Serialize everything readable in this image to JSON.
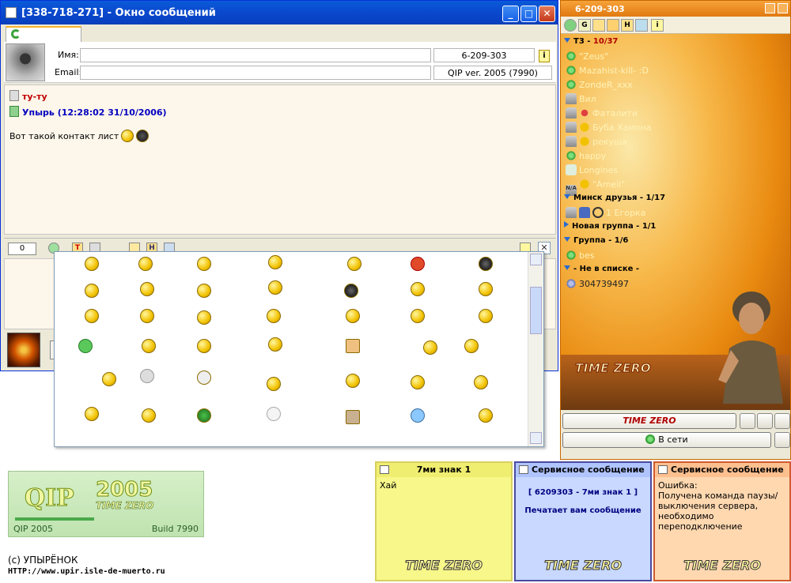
{
  "message_window": {
    "title": "[338-718-271] - Окно сообщений",
    "name_label": "Имя:",
    "email_label": "Email:",
    "uin": "6-209-303",
    "client": "QIP ver. 2005 (7990)",
    "messages": [
      {
        "author": "ту-ту"
      },
      {
        "author": "Упырь (12:28:02 31/10/2006)",
        "text": "Вот такой контакт лист"
      }
    ],
    "counter": "0",
    "toolbar_icons": [
      "T",
      "H"
    ]
  },
  "contact_list": {
    "title": "6-209-303",
    "toolbar_icons": [
      "G",
      "H",
      "i"
    ],
    "groups": [
      {
        "name": "Т3",
        "count": "10/37",
        "expanded": true,
        "contacts": [
          {
            "name": "\"Zeus\"",
            "icon": "flower-icon"
          },
          {
            "name": "Mazahist-kill- :D",
            "icon": "flower-icon"
          },
          {
            "name": "ZondeR_xxx",
            "icon": "flower-icon"
          },
          {
            "name": "Вил",
            "icon": "person-icon"
          },
          {
            "name": "Фаталити",
            "icon": "person-icon"
          },
          {
            "name": "Буба Хамона",
            "icon": "person-icon"
          },
          {
            "name": "рекуша",
            "icon": "person-icon"
          },
          {
            "name": "happy",
            "icon": "flower-icon"
          },
          {
            "name": "Longines",
            "icon": "chat-icon"
          },
          {
            "name": "\"Ameli\"",
            "icon": "na-icon"
          }
        ]
      },
      {
        "name": "Минск друзья",
        "count": "1/17",
        "expanded": true,
        "contacts": [
          {
            "name": "1 Егорка",
            "icon": "person-icon"
          }
        ]
      },
      {
        "name": "Новая группа",
        "count": "1/1",
        "expanded": false,
        "contacts": []
      },
      {
        "name": "Группа",
        "count": "1/6",
        "expanded": true,
        "contacts": [
          {
            "name": "bes",
            "icon": "flower-icon"
          }
        ]
      },
      {
        "name": "- Не в списке -",
        "count": "",
        "expanded": true,
        "contacts": [
          {
            "name": "304739497",
            "icon": "flower-icon"
          }
        ]
      }
    ],
    "logo": "TIME ZERO",
    "status_button": "В сети"
  },
  "banner": {
    "product": "QIP",
    "year": "2005",
    "sub": "TIME ZERO",
    "left": "QIP 2005",
    "right": "Build 7990",
    "copyright": "(с) УПЫРЁНОК",
    "url": "HTTP://www.upir.isle-de-muerto.ru"
  },
  "notes": [
    {
      "title": "7ми знак 1",
      "body": [
        "Хай"
      ],
      "color": "#f7f78a",
      "border": "#d8d060"
    },
    {
      "title": "Сервисное сообщение",
      "body": [
        "[ 6209303 - 7ми знак 1 ]",
        "Печатает вам сообщение"
      ],
      "color": "#c8d8ff",
      "border": "#4a4aa0"
    },
    {
      "title": "Сервисное сообщение",
      "body": [
        "Ошибка:",
        "Получена команда паузы/выключения сервера, необходимо переподключение"
      ],
      "color": "#ffd8b0",
      "border": "#d05a30"
    }
  ],
  "colors": {
    "xp_blue": "#0a4bd0",
    "orange": "#e98a10",
    "name_red": "#c00000",
    "name_blue": "#0000c0"
  }
}
